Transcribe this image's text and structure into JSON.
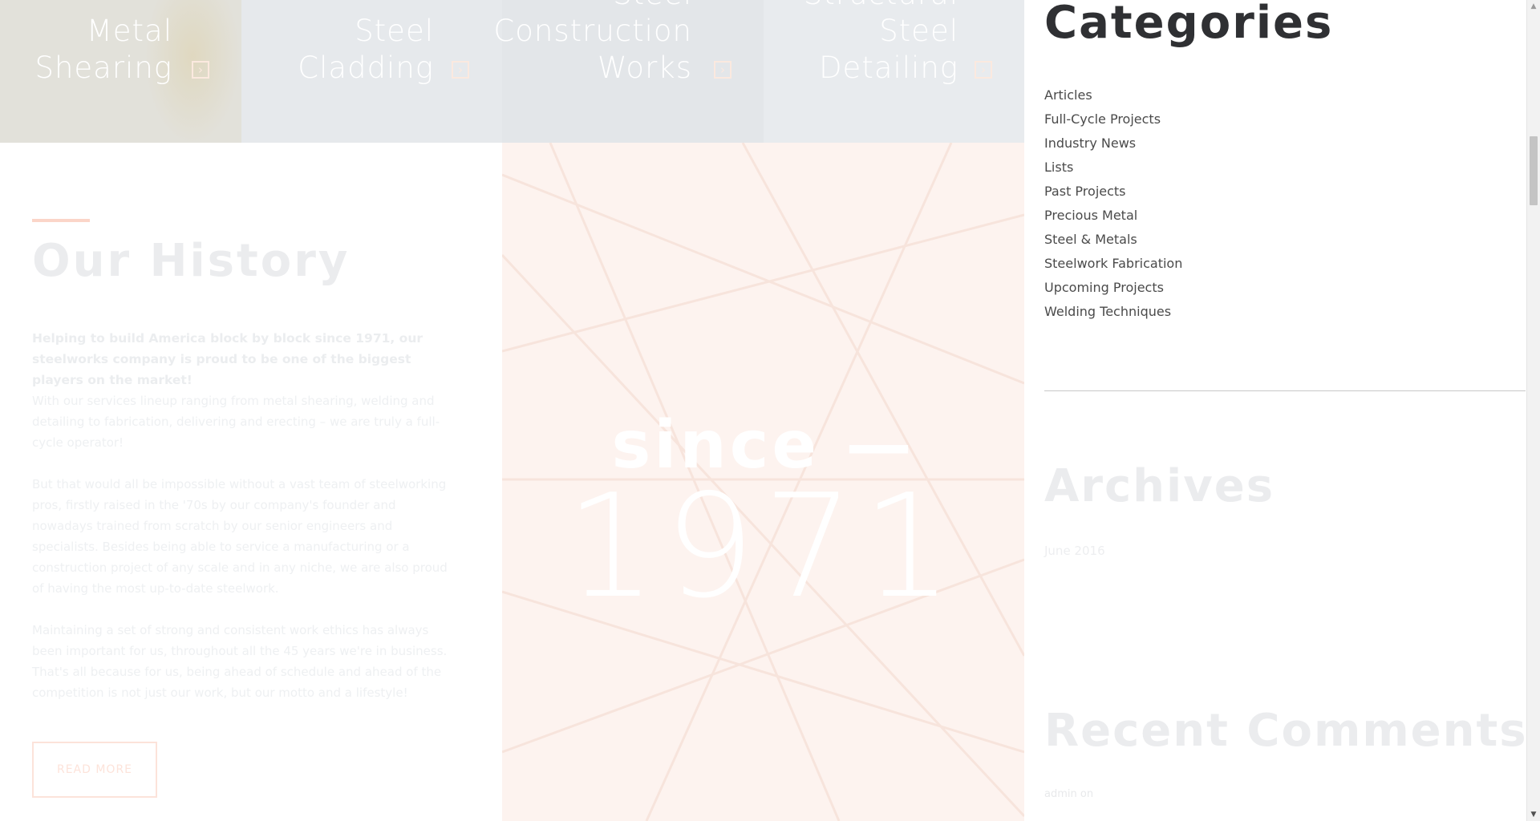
{
  "services": [
    {
      "title_lines": [
        "Metal",
        "Shearing"
      ],
      "arrow_icon": "chevron-right-icon"
    },
    {
      "title_lines": [
        "Steel",
        "Cladding"
      ],
      "arrow_icon": "chevron-right-icon"
    },
    {
      "title_lines": [
        "Steel",
        "Construction",
        "Works"
      ],
      "arrow_icon": "chevron-right-icon"
    },
    {
      "title_lines": [
        "Structural",
        "Steel",
        "Detailing"
      ],
      "arrow_icon": "chevron-right-icon"
    }
  ],
  "history": {
    "title": "Our History",
    "lead": "Helping to build America block by block since 1971, our steelworks company is proud to be one of the biggest players on the market!",
    "paragraphs": [
      "With our services lineup ranging from metal shearing, welding and detailing to fabrication, delivering and erecting – we are truly a full-cycle operator!",
      "But that would all be impossible without a vast team of steelworking pros, firstly raised in the '70s by our company's founder and nowadays trained from scratch by our senior engineers and specialists. Besides being able to service a manufacturing or a construction project of any scale and in any niche, we are also proud of having the most up-to-date steelwork.",
      "Maintaining a set of strong and consistent work ethics has always been important for us, throughout all the 45 years we're in business. That's all because for us, being ahead of schedule and ahead of the competition is not just our work, but our motto and a lifestyle!"
    ],
    "button_label": "READ MORE"
  },
  "since": {
    "word": "since —",
    "year": "1971"
  },
  "sidebar": {
    "categories_title": "Categories",
    "categories": [
      "Articles",
      "Full-Cycle Projects",
      "Industry News",
      "Lists",
      "Past Projects",
      "Precious Metal",
      "Steel & Metals",
      "Steelwork Fabrication",
      "Upcoming Projects",
      "Welding Techniques"
    ],
    "archives_title": "Archives",
    "archives": [
      "June 2016"
    ],
    "recent_comments_title": "Recent Comments",
    "recent_comment": "admin on"
  },
  "colors": {
    "accent": "#fbd5c8",
    "since_panel_bg": "#fdf3ef",
    "heading_dark": "#2f3033"
  }
}
